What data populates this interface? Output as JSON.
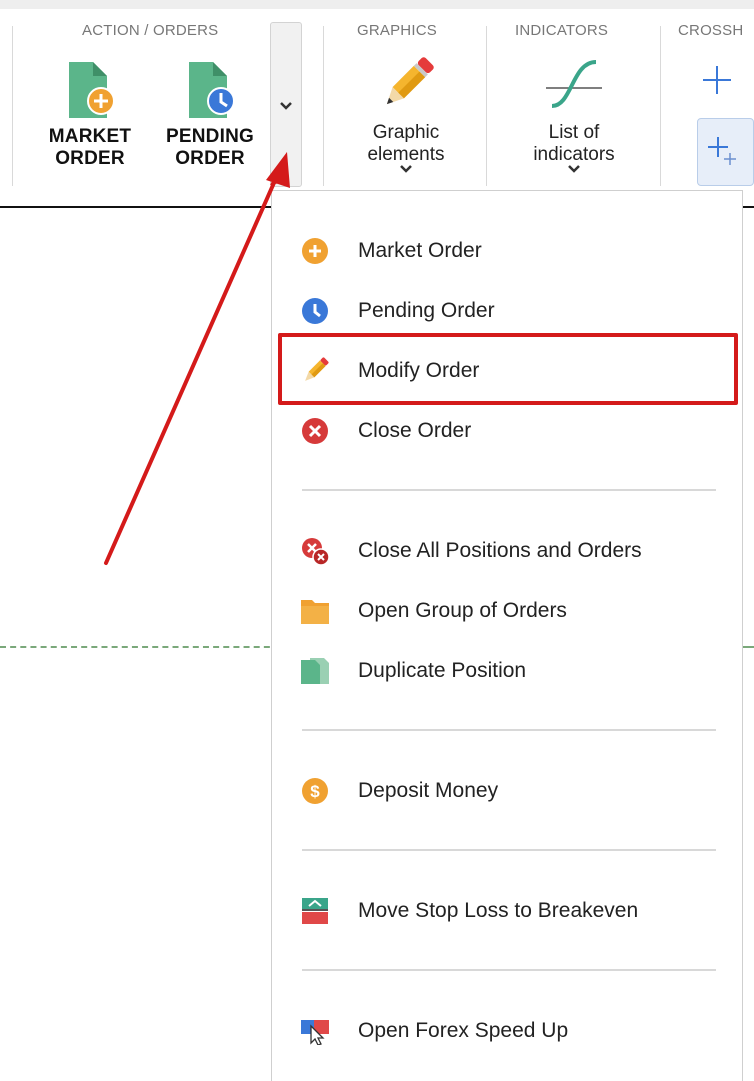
{
  "ribbon": {
    "groups": {
      "action_orders": "ACTION / ORDERS",
      "graphics": "GRAPHICS",
      "indicators": "INDICATORS",
      "crosshair": "CROSSH"
    },
    "market_order": {
      "line1": "MARKET",
      "line2": "ORDER",
      "icon": "market-order-icon"
    },
    "pending_order": {
      "line1": "PENDING",
      "line2": "ORDER",
      "icon": "pending-order-icon"
    },
    "graphic_elements": {
      "line1": "Graphic",
      "line2": "elements",
      "icon": "pencil-icon"
    },
    "list_of_indicators": {
      "line1": "List of",
      "line2": "indicators",
      "icon": "indicator-curve-icon"
    }
  },
  "menu": {
    "items": [
      {
        "label": "Market Order",
        "icon": "plus-circle-icon"
      },
      {
        "label": "Pending Order",
        "icon": "clock-icon"
      },
      {
        "label": "Modify Order",
        "icon": "pencil-icon"
      },
      {
        "label": "Close Order",
        "icon": "close-circle-icon"
      },
      {
        "label": "Close All Positions and Orders",
        "icon": "close-all-icon"
      },
      {
        "label": "Open Group of Orders",
        "icon": "folder-icon"
      },
      {
        "label": "Duplicate Position",
        "icon": "duplicate-icon"
      },
      {
        "label": "Deposit Money",
        "icon": "dollar-icon"
      },
      {
        "label": "Move Stop Loss to Breakeven",
        "icon": "breakeven-icon"
      },
      {
        "label": "Open Forex Speed Up",
        "icon": "speed-up-icon"
      }
    ]
  },
  "colors": {
    "accent_orange": "#f0a131",
    "accent_blue": "#3a78d8",
    "accent_red": "#d63a3a",
    "accent_green": "#5bb58a",
    "highlight_red": "#d41a1a"
  }
}
